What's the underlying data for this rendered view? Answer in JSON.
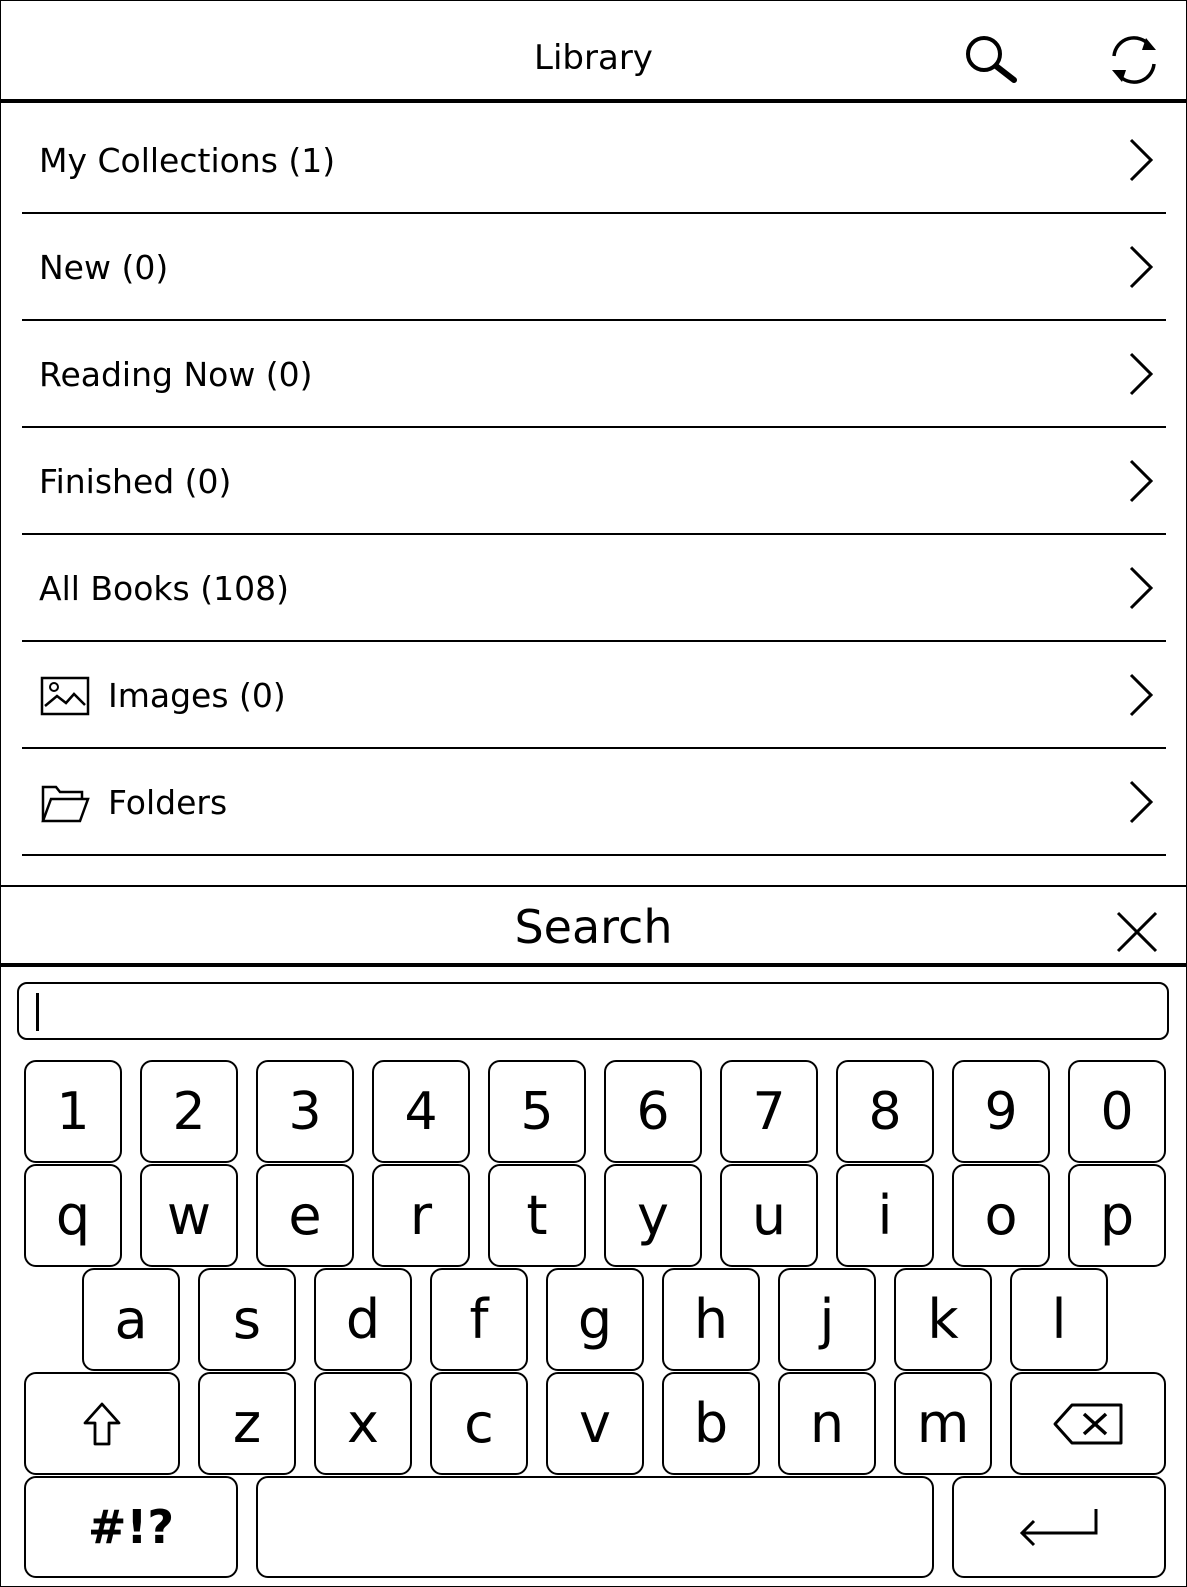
{
  "header": {
    "title": "Library",
    "search_icon": "search-icon",
    "sync_icon": "sync-icon"
  },
  "library": {
    "items": [
      {
        "label": "My Collections (1)"
      },
      {
        "label": "New (0)"
      },
      {
        "label": "Reading Now (0)"
      },
      {
        "label": "Finished (0)"
      },
      {
        "label": "All Books (108)"
      },
      {
        "label": "Images (0)",
        "icon": "image-icon"
      },
      {
        "label": "Folders",
        "icon": "folder-icon"
      }
    ]
  },
  "search_panel": {
    "title": "Search",
    "close_icon": "close-icon",
    "input_value": ""
  },
  "keyboard": {
    "row1": [
      "1",
      "2",
      "3",
      "4",
      "5",
      "6",
      "7",
      "8",
      "9",
      "0"
    ],
    "row2": [
      "q",
      "w",
      "e",
      "r",
      "t",
      "y",
      "u",
      "i",
      "o",
      "p"
    ],
    "row3": [
      "a",
      "s",
      "d",
      "f",
      "g",
      "h",
      "j",
      "k",
      "l"
    ],
    "row4": [
      "z",
      "x",
      "c",
      "v",
      "b",
      "n",
      "m"
    ],
    "shift_icon": "shift-icon",
    "backspace_icon": "backspace-icon",
    "symbols_label": "#!?",
    "enter_icon": "enter-icon"
  }
}
